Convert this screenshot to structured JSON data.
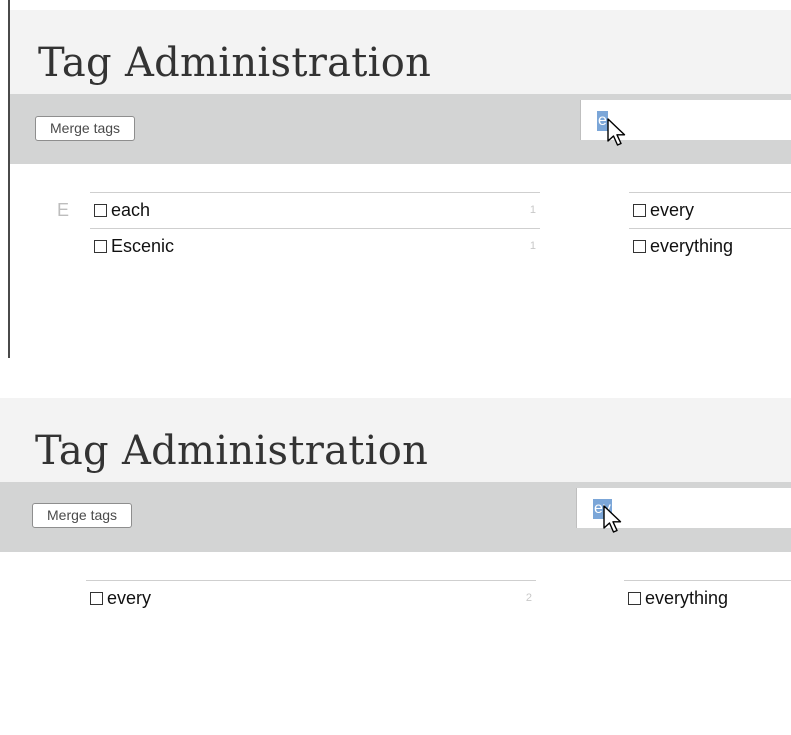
{
  "panels": [
    {
      "title": "Tag Administration",
      "merge_button": "Merge tags",
      "search_value": "e",
      "letter": "E",
      "left_column": [
        {
          "name": "each",
          "count": "1"
        },
        {
          "name": "Escenic",
          "count": "1"
        }
      ],
      "right_column": [
        {
          "name": "every"
        },
        {
          "name": "everything"
        }
      ]
    },
    {
      "title": "Tag Administration",
      "merge_button": "Merge tags",
      "search_value": "ev",
      "left_column": [
        {
          "name": "every",
          "count": "2"
        }
      ],
      "right_column": [
        {
          "name": "everything"
        }
      ]
    }
  ],
  "colors": {
    "title_bar": "#f3f3f3",
    "toolbar": "#d3d4d4",
    "selection": "#7ba6d8",
    "count_text": "#c8c8c8"
  },
  "icons": [
    "checkbox-icon",
    "mouse-cursor-icon"
  ]
}
